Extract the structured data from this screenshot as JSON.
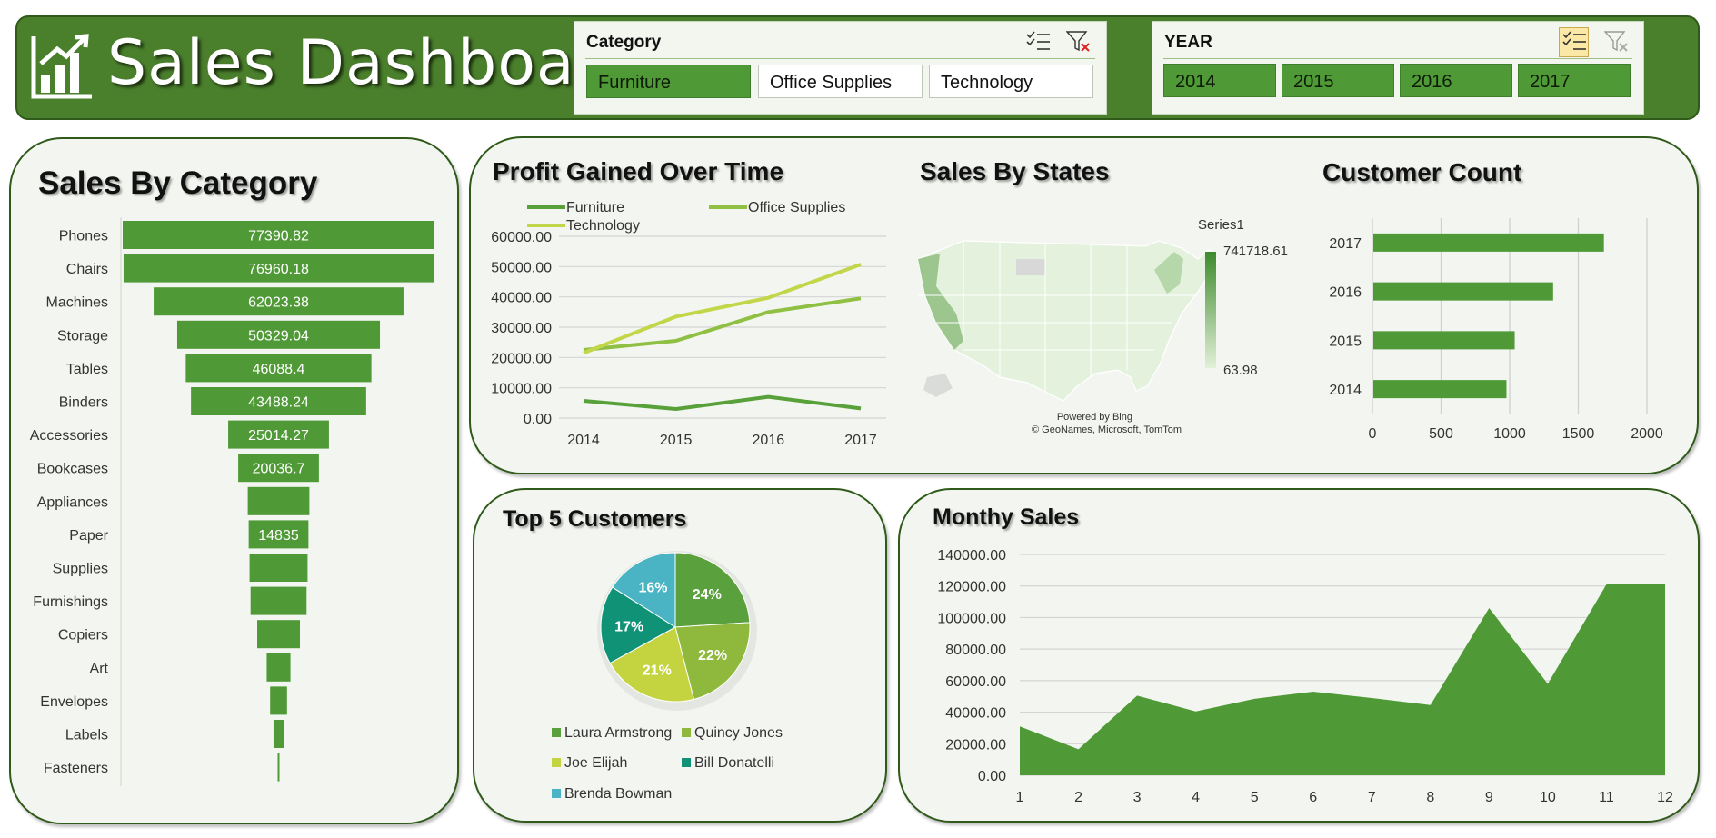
{
  "header": {
    "title": "Sales Dashboard",
    "category_slicer": {
      "title": "Category",
      "items": [
        {
          "label": "Furniture",
          "selected": true
        },
        {
          "label": "Office Supplies",
          "selected": false
        },
        {
          "label": "Technology",
          "selected": false
        }
      ]
    },
    "year_slicer": {
      "title": "YEAR",
      "items": [
        {
          "label": "2014",
          "selected": true
        },
        {
          "label": "2015",
          "selected": true
        },
        {
          "label": "2016",
          "selected": true
        },
        {
          "label": "2017",
          "selected": true
        }
      ]
    }
  },
  "colors": {
    "header_bg": "#4a7f2c",
    "bar_green": "#4f9a36",
    "panel_bg": "#f3f6f0",
    "panel_border": "#2f5a1a",
    "furniture_line": "#57a03a",
    "office_line": "#8fc043",
    "technology_line": "#c3d64a",
    "pie": [
      "#5aa03c",
      "#8fb93c",
      "#c4d340",
      "#0f9276",
      "#4ab4c4"
    ]
  },
  "chart_data": [
    {
      "id": "sales_by_category",
      "type": "bar",
      "orientation": "horizontal-funnel",
      "title": "Sales By Category",
      "categories": [
        "Phones",
        "Chairs",
        "Machines",
        "Storage",
        "Tables",
        "Binders",
        "Accessories",
        "Bookcases",
        "Appliances",
        "Paper",
        "Supplies",
        "Furnishings",
        "Copiers",
        "Art",
        "Envelopes",
        "Labels",
        "Fasteners"
      ],
      "values": [
        77390.82,
        76960.18,
        62023.38,
        50329.04,
        46088.4,
        43488.24,
        25014.27,
        20036.7,
        15300,
        14835,
        14400,
        13900,
        10600,
        5900,
        4200,
        2500,
        300
      ],
      "data_labels": [
        "77390.82",
        "76960.18",
        "62023.38",
        "50329.04",
        "46088.4",
        "43488.24",
        "25014.27",
        "20036.7",
        "",
        "14835",
        "",
        "",
        "",
        "",
        "",
        "",
        ""
      ]
    },
    {
      "id": "profit_over_time",
      "type": "line",
      "title": "Profit Gained Over Time",
      "x": [
        "2014",
        "2015",
        "2016",
        "2017"
      ],
      "series": [
        {
          "name": "Furniture",
          "values": [
            5700,
            3000,
            7000,
            3200
          ]
        },
        {
          "name": "Office Supplies",
          "values": [
            22500,
            25500,
            35000,
            39500
          ]
        },
        {
          "name": "Technology",
          "values": [
            21500,
            33500,
            39700,
            50700
          ]
        }
      ],
      "ylim": [
        0,
        60000
      ],
      "yticks": [
        "60000.00",
        "50000.00",
        "40000.00",
        "30000.00",
        "20000.00",
        "10000.00",
        "0.00"
      ],
      "grid": true,
      "legend": "top"
    },
    {
      "id": "sales_by_states",
      "type": "heatmap",
      "title": "Sales By States",
      "legend_title": "Series1",
      "max_label": "741718.61",
      "min_label": "63.98",
      "credits": [
        "Powered by Bing",
        "© GeoNames, Microsoft, TomTom"
      ]
    },
    {
      "id": "customer_count",
      "type": "bar",
      "orientation": "horizontal",
      "title": "Customer Count",
      "categories": [
        "2017",
        "2016",
        "2015",
        "2014"
      ],
      "values": [
        1680,
        1310,
        1030,
        970
      ],
      "xlim": [
        0,
        2000
      ],
      "xticks": [
        "0",
        "500",
        "1000",
        "1500",
        "2000"
      ]
    },
    {
      "id": "top5_customers",
      "type": "pie",
      "title": "Top 5 Customers",
      "labels": [
        "Laura Armstrong",
        "Quincy Jones",
        "Joe Elijah",
        "Bill Donatelli",
        "Brenda Bowman"
      ],
      "values": [
        24,
        22,
        21,
        17,
        16
      ],
      "data_labels": [
        "24%",
        "22%",
        "21%",
        "17%",
        "16%"
      ]
    },
    {
      "id": "monthly_sales",
      "type": "area",
      "title": "Monthy Sales",
      "x": [
        "1",
        "2",
        "3",
        "4",
        "5",
        "6",
        "7",
        "8",
        "9",
        "10",
        "11",
        "12"
      ],
      "values": [
        31000,
        16500,
        50500,
        40500,
        48500,
        53000,
        49000,
        44500,
        106000,
        58000,
        121000,
        121500
      ],
      "ylim": [
        0,
        140000
      ],
      "yticks": [
        "140000.00",
        "120000.00",
        "100000.00",
        "80000.00",
        "60000.00",
        "40000.00",
        "20000.00",
        "0.00"
      ],
      "grid": true
    }
  ]
}
